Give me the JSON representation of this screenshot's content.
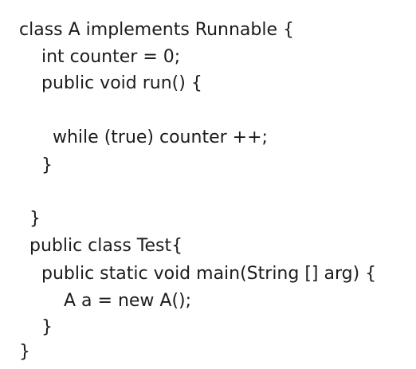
{
  "code": {
    "lines": [
      "class A implements Runnable {",
      "int counter = 0;",
      "public void run() {",
      "while (true) counter ++;",
      "}",
      "}",
      "public class Test{",
      "public static void main(String [] arg) {",
      "A a = new A();",
      "}",
      "}"
    ]
  }
}
